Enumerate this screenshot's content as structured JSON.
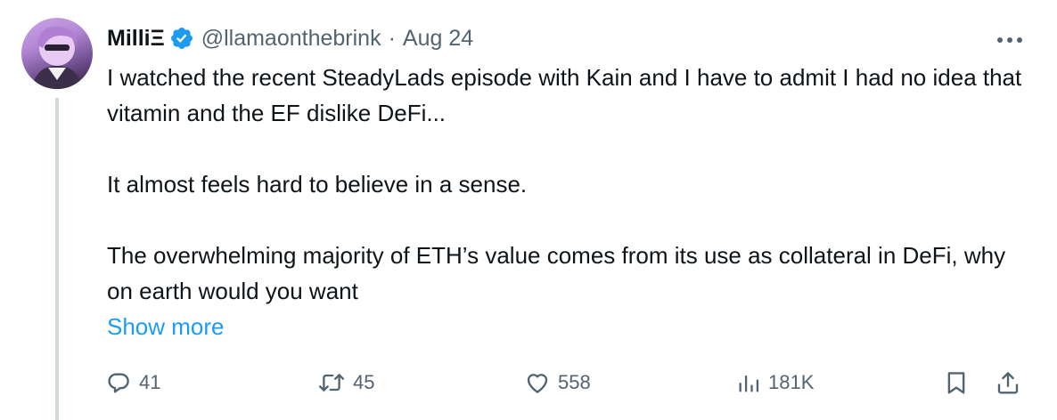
{
  "author": {
    "display_name": "Milli",
    "name_glyph": "Ξ",
    "verified": true,
    "handle": "@llamaonthebrink",
    "separator": "·",
    "date": "Aug 24"
  },
  "tweet": {
    "paragraphs": [
      "I watched the recent SteadyLads episode with Kain and I have to admit I had no idea that vitamin and the EF dislike DeFi...",
      "It almost feels hard to believe in a sense.",
      "The overwhelming majority of ETH’s value comes from its use as collateral in DeFi, why on earth would you want"
    ],
    "show_more_label": "Show more"
  },
  "actions": {
    "replies": "41",
    "reposts": "45",
    "likes": "558",
    "views": "181K"
  },
  "colors": {
    "text": "#0f1419",
    "secondary": "#536471",
    "link": "#1d9bf0",
    "verified_badge": "#1d9bf0",
    "thread_line": "#cfd9de"
  },
  "icons": {
    "more": "more-icon",
    "verified": "verified-badge-icon",
    "reply": "reply-icon",
    "repost": "repost-icon",
    "like": "like-icon",
    "views": "views-icon",
    "bookmark": "bookmark-icon",
    "share": "share-icon"
  }
}
